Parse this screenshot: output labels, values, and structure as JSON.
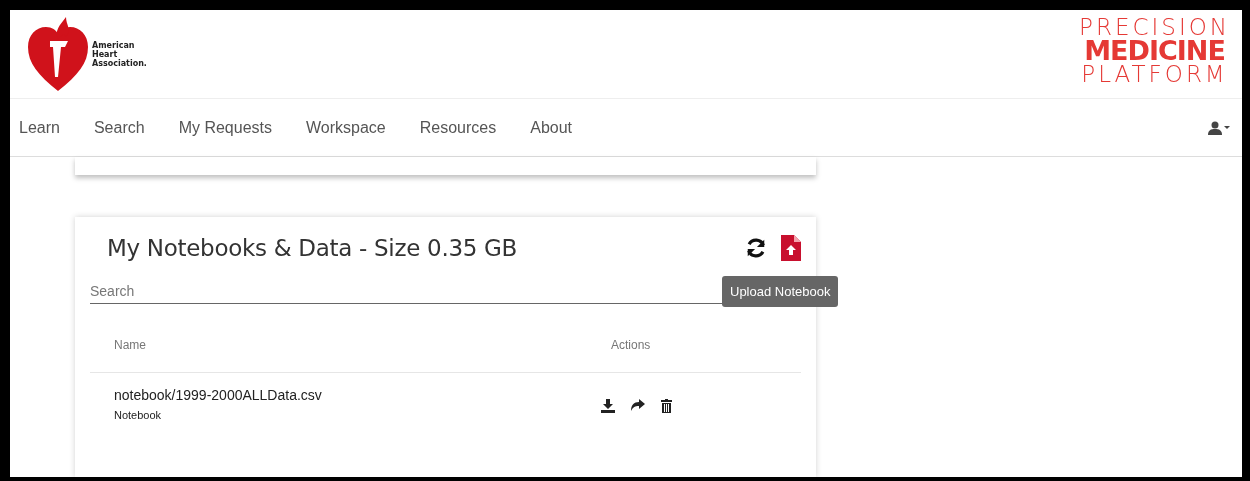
{
  "header": {
    "org_logo": {
      "lines": [
        "American",
        "Heart",
        "Association."
      ]
    },
    "platform_logo": {
      "lines": [
        "PRECISION",
        "MEDICINE",
        "PLATFORM"
      ]
    }
  },
  "nav": {
    "items": [
      {
        "label": "Learn",
        "selected": false
      },
      {
        "label": "Search",
        "selected": false
      },
      {
        "label": "My Requests",
        "selected": false
      },
      {
        "label": "Workspace",
        "selected": false
      },
      {
        "label": "Resources",
        "selected": false
      },
      {
        "label": "About",
        "selected": false
      }
    ]
  },
  "notebooks_card": {
    "title": "My Notebooks & Data - Size 0.35 GB",
    "search": {
      "placeholder": "Search"
    },
    "tooltip": "Upload Notebook",
    "table": {
      "columns": [
        "Name",
        "Actions"
      ],
      "rows": [
        {
          "name": "notebook/1999-2000ALLData.csv",
          "type": "Notebook"
        }
      ]
    }
  }
}
